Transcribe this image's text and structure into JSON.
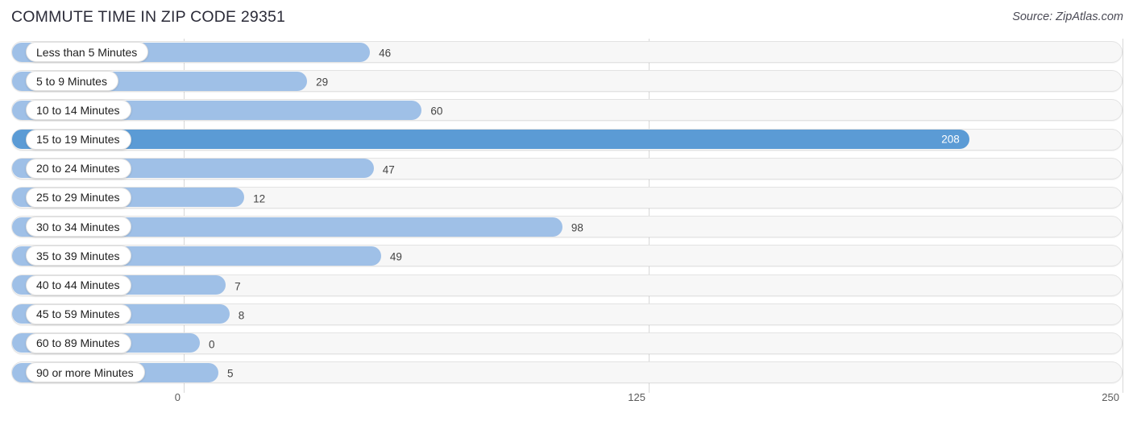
{
  "header": {
    "title": "COMMUTE TIME IN ZIP CODE 29351",
    "source": "Source: ZipAtlas.com"
  },
  "axis": {
    "ticks": [
      "0",
      "125",
      "250"
    ]
  },
  "colors": {
    "bar": "#9fc0e7",
    "bar_highlight": "#5b9bd5",
    "track": "#f7f7f7",
    "gridline": "#d8d8d8",
    "value_text": "#444444",
    "value_text_inverse": "#ffffff"
  },
  "chart_data": {
    "type": "bar",
    "orientation": "horizontal",
    "title": "COMMUTE TIME IN ZIP CODE 29351",
    "xlabel": "",
    "ylabel": "",
    "xlim": [
      0,
      250
    ],
    "xticks": [
      0,
      125,
      250
    ],
    "grid": true,
    "legend": "none",
    "categories": [
      "Less than 5 Minutes",
      "5 to 9 Minutes",
      "10 to 14 Minutes",
      "15 to 19 Minutes",
      "20 to 24 Minutes",
      "25 to 29 Minutes",
      "30 to 34 Minutes",
      "35 to 39 Minutes",
      "40 to 44 Minutes",
      "45 to 59 Minutes",
      "60 to 89 Minutes",
      "90 or more Minutes"
    ],
    "values": [
      46,
      29,
      60,
      208,
      47,
      12,
      98,
      49,
      7,
      8,
      0,
      5
    ],
    "highlight_index": 3
  },
  "rows": [
    {
      "label": "Less than 5 Minutes",
      "value": 46,
      "value_text": "46",
      "highlight": false
    },
    {
      "label": "5 to 9 Minutes",
      "value": 29,
      "value_text": "29",
      "highlight": false
    },
    {
      "label": "10 to 14 Minutes",
      "value": 60,
      "value_text": "60",
      "highlight": false
    },
    {
      "label": "15 to 19 Minutes",
      "value": 208,
      "value_text": "208",
      "highlight": true
    },
    {
      "label": "20 to 24 Minutes",
      "value": 47,
      "value_text": "47",
      "highlight": false
    },
    {
      "label": "25 to 29 Minutes",
      "value": 12,
      "value_text": "12",
      "highlight": false
    },
    {
      "label": "30 to 34 Minutes",
      "value": 98,
      "value_text": "98",
      "highlight": false
    },
    {
      "label": "35 to 39 Minutes",
      "value": 49,
      "value_text": "49",
      "highlight": false
    },
    {
      "label": "40 to 44 Minutes",
      "value": 7,
      "value_text": "7",
      "highlight": false
    },
    {
      "label": "45 to 59 Minutes",
      "value": 8,
      "value_text": "8",
      "highlight": false
    },
    {
      "label": "60 to 89 Minutes",
      "value": 0,
      "value_text": "0",
      "highlight": false
    },
    {
      "label": "90 or more Minutes",
      "value": 5,
      "value_text": "5",
      "highlight": false
    }
  ]
}
